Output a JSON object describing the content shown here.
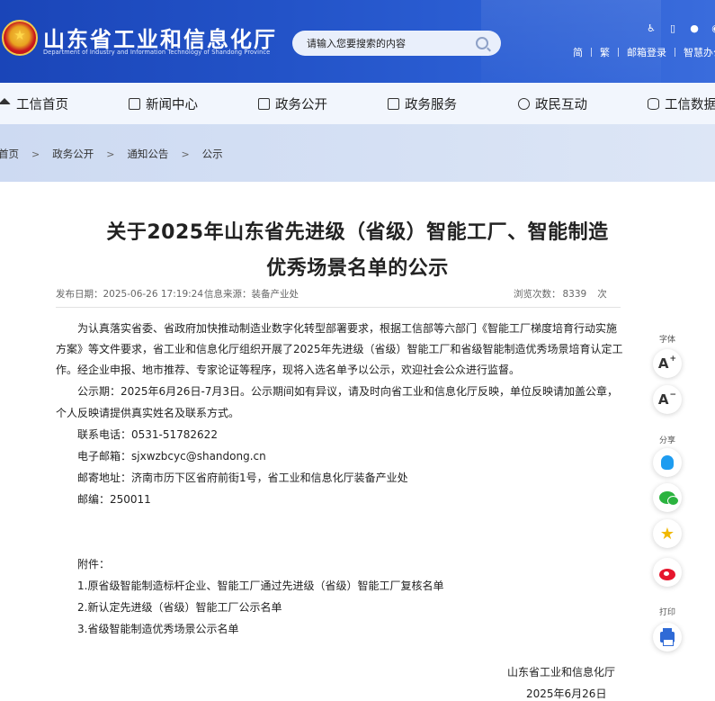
{
  "header": {
    "site_title": "山东省工业和信息化厅",
    "site_subtitle": "Department of Industry and Information Technology of Shandong Province",
    "search_placeholder": "请输入您要搜索的内容",
    "links": [
      "简",
      "繁",
      "邮箱登录",
      "智慧办公"
    ],
    "top_icons": [
      "accessibility-icon",
      "mobile-icon",
      "wechat-icon",
      "weibo-icon"
    ]
  },
  "nav": {
    "items": [
      {
        "label": "工信首页",
        "icon": "home-icon"
      },
      {
        "label": "新闻中心",
        "icon": "news-icon"
      },
      {
        "label": "政务公开",
        "icon": "monitor-icon"
      },
      {
        "label": "政务服务",
        "icon": "service-icon"
      },
      {
        "label": "政民互动",
        "icon": "interaction-icon"
      },
      {
        "label": "工信数据",
        "icon": "database-icon"
      }
    ]
  },
  "breadcrumb": [
    "首页",
    "政务公开",
    "通知公告",
    "公示"
  ],
  "article": {
    "title_line1": "关于2025年山东省先进级（省级）智能工厂、智能制造",
    "title_line2": "优秀场景名单的公示",
    "publish_label": "发布日期：",
    "publish_date": "2025-06-26 17:19:24",
    "source_label": "信息来源：",
    "source": "装备产业处",
    "views_label": "浏览次数：",
    "views": "8339",
    "views_unit": "次",
    "paragraphs": [
      "为认真落实省委、省政府加快推动制造业数字化转型部署要求，根据工信部等六部门《智能工厂梯度培育行动实施",
      "方案》等文件要求，省工业和信息化厅组织开展了2025年先进级（省级）智能工厂和省级智能制造优秀场景培育认定工",
      "作。经企业申报、地市推荐、专家论证等程序，现将入选名单予以公示，欢迎社会公众进行监督。",
      "公示期：2025年6月26日-7月3日。公示期间如有异议，请及时向省工业和信息化厅反映，单位反映请加盖公章，",
      "个人反映请提供真实姓名及联系方式。"
    ],
    "contact_phone": "联系电话：0531-51782622",
    "contact_email": "电子邮箱：sjxwzbcyc@shandong.cn",
    "contact_address": "邮寄地址：济南市历下区省府前街1号，省工业和信息化厅装备产业处",
    "postcode": "邮编：250011",
    "attachments_label": "附件：",
    "attachments": [
      "1.原省级智能制造标杆企业、智能工厂通过先进级（省级）智能工厂复核名单",
      "2.新认定先进级（省级）智能工厂公示名单",
      "3.省级智能制造优秀场景公示名单"
    ],
    "signature": "山东省工业和信息化厅",
    "sign_date": "2025年6月26日"
  },
  "sidebar_tools": {
    "font_label": "字体",
    "font_increase": "A",
    "font_decrease": "A",
    "share_label": "分享",
    "print_label": "打印"
  },
  "colors": {
    "header_blue": "#2353c8",
    "nav_bg": "#f2f6fd",
    "breadcrumb_bg": "#d6e1f4"
  }
}
